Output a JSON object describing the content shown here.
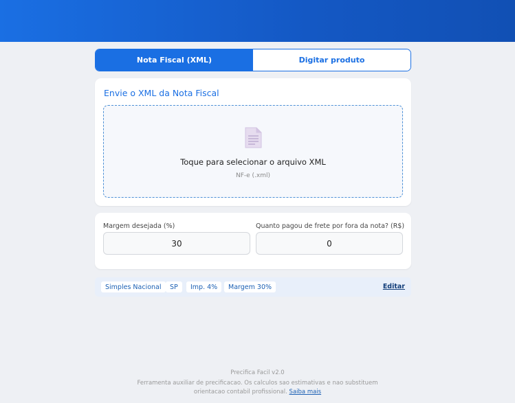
{
  "tabs": [
    {
      "label": "Nota Fiscal (XML)",
      "active": true
    },
    {
      "label": "Digitar produto",
      "active": false
    }
  ],
  "upload": {
    "title": "Envie o XML da Nota Fiscal",
    "drop_text": "Toque para selecionar o arquivo XML",
    "drop_hint": "NF-e (.xml)",
    "icon": "document-icon"
  },
  "fields": {
    "margin_label": "Margem desejada (%)",
    "margin_value": "30",
    "freight_label": "Quanto pagou de frete por fora da nota? (R$)",
    "freight_value": "0"
  },
  "summary": {
    "chips": [
      "Simples Nacional",
      "SP",
      "Imp. 4%",
      "Margem 30%"
    ],
    "edit_label": "Editar"
  },
  "footer": {
    "version": "Precifica Facil v2.0",
    "disclaimer_line1": "Ferramenta auxiliar de precificacao. Os calculos sao estimativas e nao substituem",
    "disclaimer_line2": "orientacao contabil profissional.",
    "link": "Saiba mais"
  },
  "colors": {
    "accent": "#1a6fe3",
    "background": "#eef0f4"
  }
}
